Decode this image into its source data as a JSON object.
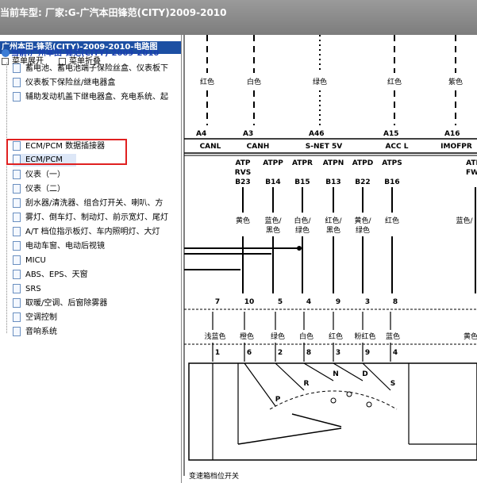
{
  "window": {
    "title": "当前车型:  厂家:G-广汽本田锋范(CITY)2009-2010"
  },
  "left_panel": {
    "header": "广州本田-锋范(CITY)-2009-2010-电路图",
    "toolbar": {
      "expand": "菜单展开",
      "collapse": "菜单折叠"
    },
    "root": "当前:广州本田-锋范(CITY)-2009-2010",
    "items": [
      {
        "label": "蓄电池、蓄电池端子保险丝盒、仪表板下"
      },
      {
        "label": "仪表板下保险丝/继电器盒"
      },
      {
        "label": "辅助发动机盖下继电器盒、充电系统、起"
      },
      {
        "label": "ECM/PCM 数据插接器"
      },
      {
        "label": "ECM/PCM"
      },
      {
        "label": "仪表（一）"
      },
      {
        "label": "仪表（二）"
      },
      {
        "label": "刮水器/清洗器、组合灯开关、喇叭、方"
      },
      {
        "label": "雾灯、倒车灯、制动灯、前示宽灯、尾灯"
      },
      {
        "label": "A/T 档位指示板灯、车内照明灯、大灯"
      },
      {
        "label": "电动车窗、电动后视镜"
      },
      {
        "label": "MICU"
      },
      {
        "label": "ABS、EPS、天窗"
      },
      {
        "label": "SRS"
      },
      {
        "label": "取暖/空调、后窗除雾器"
      },
      {
        "label": "空调控制"
      },
      {
        "label": "音响系统"
      }
    ]
  },
  "diagram": {
    "top_wires": [
      {
        "color": "红色",
        "pin": "A4",
        "style": "dash"
      },
      {
        "color": "白色",
        "pin": "A3",
        "style": "dash"
      },
      {
        "color": "绿色",
        "pin": "A46",
        "style": "dot"
      },
      {
        "color": "红色",
        "pin": "A15",
        "style": "dash"
      },
      {
        "color": "紫色",
        "pin": "A16",
        "style": "dash"
      }
    ],
    "bus_labels": [
      "CANL",
      "CANH",
      "S-NET 5V",
      "ACC L",
      "IMOFPR"
    ],
    "signals": [
      {
        "name": "ATP\nRVS",
        "pin": "B23",
        "upper_color": "黄色",
        "pos": "7",
        "lower_color": "浅蓝色",
        "bottom_pin": "1"
      },
      {
        "name": "ATPP",
        "pin": "B14",
        "upper_color": "蓝色/\n黑色",
        "pos": "10",
        "lower_color": "橙色",
        "bottom_pin": "6"
      },
      {
        "name": "ATPR",
        "pin": "B15",
        "upper_color": "白色/\n绿色",
        "pos": "5",
        "lower_color": "绿色",
        "bottom_pin": "2"
      },
      {
        "name": "ATPN",
        "pin": "B13",
        "upper_color": "红色/\n黑色",
        "pos": "4",
        "lower_color": "白色",
        "bottom_pin": "8"
      },
      {
        "name": "ATPD",
        "pin": "B22",
        "upper_color": "黄色/\n绿色",
        "pos": "9",
        "lower_color": "红色",
        "bottom_pin": "3"
      },
      {
        "name": "ATPS",
        "pin": "B16",
        "upper_color": "红色",
        "pos": "3",
        "lower_color": "粉红色",
        "bottom_pin": "9"
      },
      {
        "name": "",
        "pin": "",
        "upper_color": "",
        "pos": "8",
        "lower_color": "蓝色",
        "bottom_pin": "4"
      }
    ],
    "right_partial": {
      "top": "ATI\nFW",
      "upper_color": "蓝色/",
      "lower_color": "黄色"
    },
    "switch_positions": [
      "P",
      "R",
      "N",
      "D",
      "S"
    ],
    "switch_title": "变速箱档位开关"
  }
}
